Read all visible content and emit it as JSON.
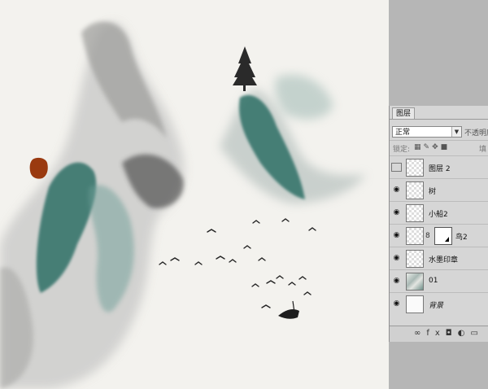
{
  "layers_panel": {
    "tab_label": "图层",
    "blend_mode": "正常",
    "opacity_label": "不透明度",
    "lock_label": "锁定:",
    "fill_label": "填",
    "layers": [
      {
        "name": "图层 2",
        "visible": false,
        "thumb": "transparent"
      },
      {
        "name": "树",
        "visible": true,
        "thumb": "transparent"
      },
      {
        "name": "小船2",
        "visible": true,
        "thumb": "transparent"
      },
      {
        "name": "鸟2",
        "visible": true,
        "thumb": "transparent",
        "mask": true
      },
      {
        "name": "水墨印章",
        "visible": true,
        "thumb": "transparent"
      },
      {
        "name": "01",
        "visible": true,
        "thumb": "photo"
      },
      {
        "name": "背景",
        "visible": true,
        "thumb": "white"
      }
    ]
  },
  "icons": {
    "eye": "eye-icon",
    "link": "link-icon",
    "fx": "fx-icon",
    "mask": "add-mask-icon",
    "adjust": "adjustment-icon",
    "new_layer": "new-layer-icon"
  },
  "colors": {
    "canvas_bg": "#f3f2ee",
    "ink_teal": "#2f6f66",
    "seal_red": "#9a3a10",
    "panel_bg": "#d6d6d6"
  }
}
